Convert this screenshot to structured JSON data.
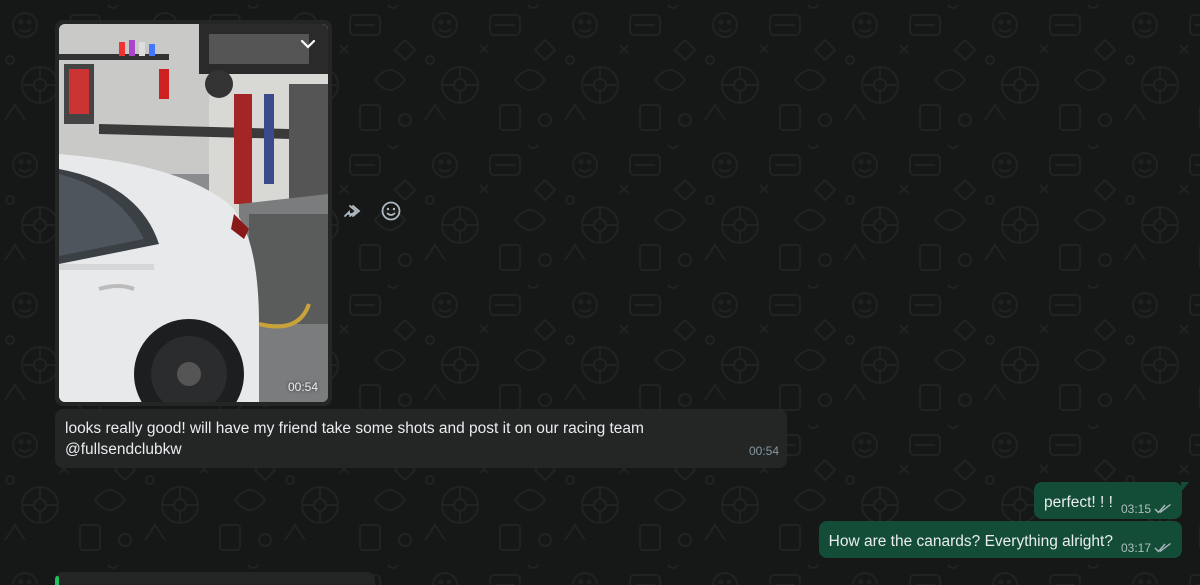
{
  "chat": {
    "image_message": {
      "time": "00:54",
      "menu_icon": "chevron-down-icon"
    },
    "hover_actions": {
      "forward_icon": "forward-icon",
      "react_icon": "emoji-icon"
    },
    "text_message": {
      "line1": "looks really good! will have my friend take some shots and post it on our racing team",
      "line2": "@fullsendclubkw",
      "time": "00:54"
    },
    "outgoing": [
      {
        "text": "perfect! ! !",
        "time": "03:15",
        "status_icon": "double-check-icon"
      },
      {
        "text": "How are the canards? Everything alright?",
        "time": "03:17",
        "status_icon": "double-check-icon"
      }
    ]
  },
  "colors": {
    "background": "#161717",
    "incoming_bubble": "#242626",
    "outgoing_bubble": "#144d37",
    "accent": "#21c063"
  }
}
